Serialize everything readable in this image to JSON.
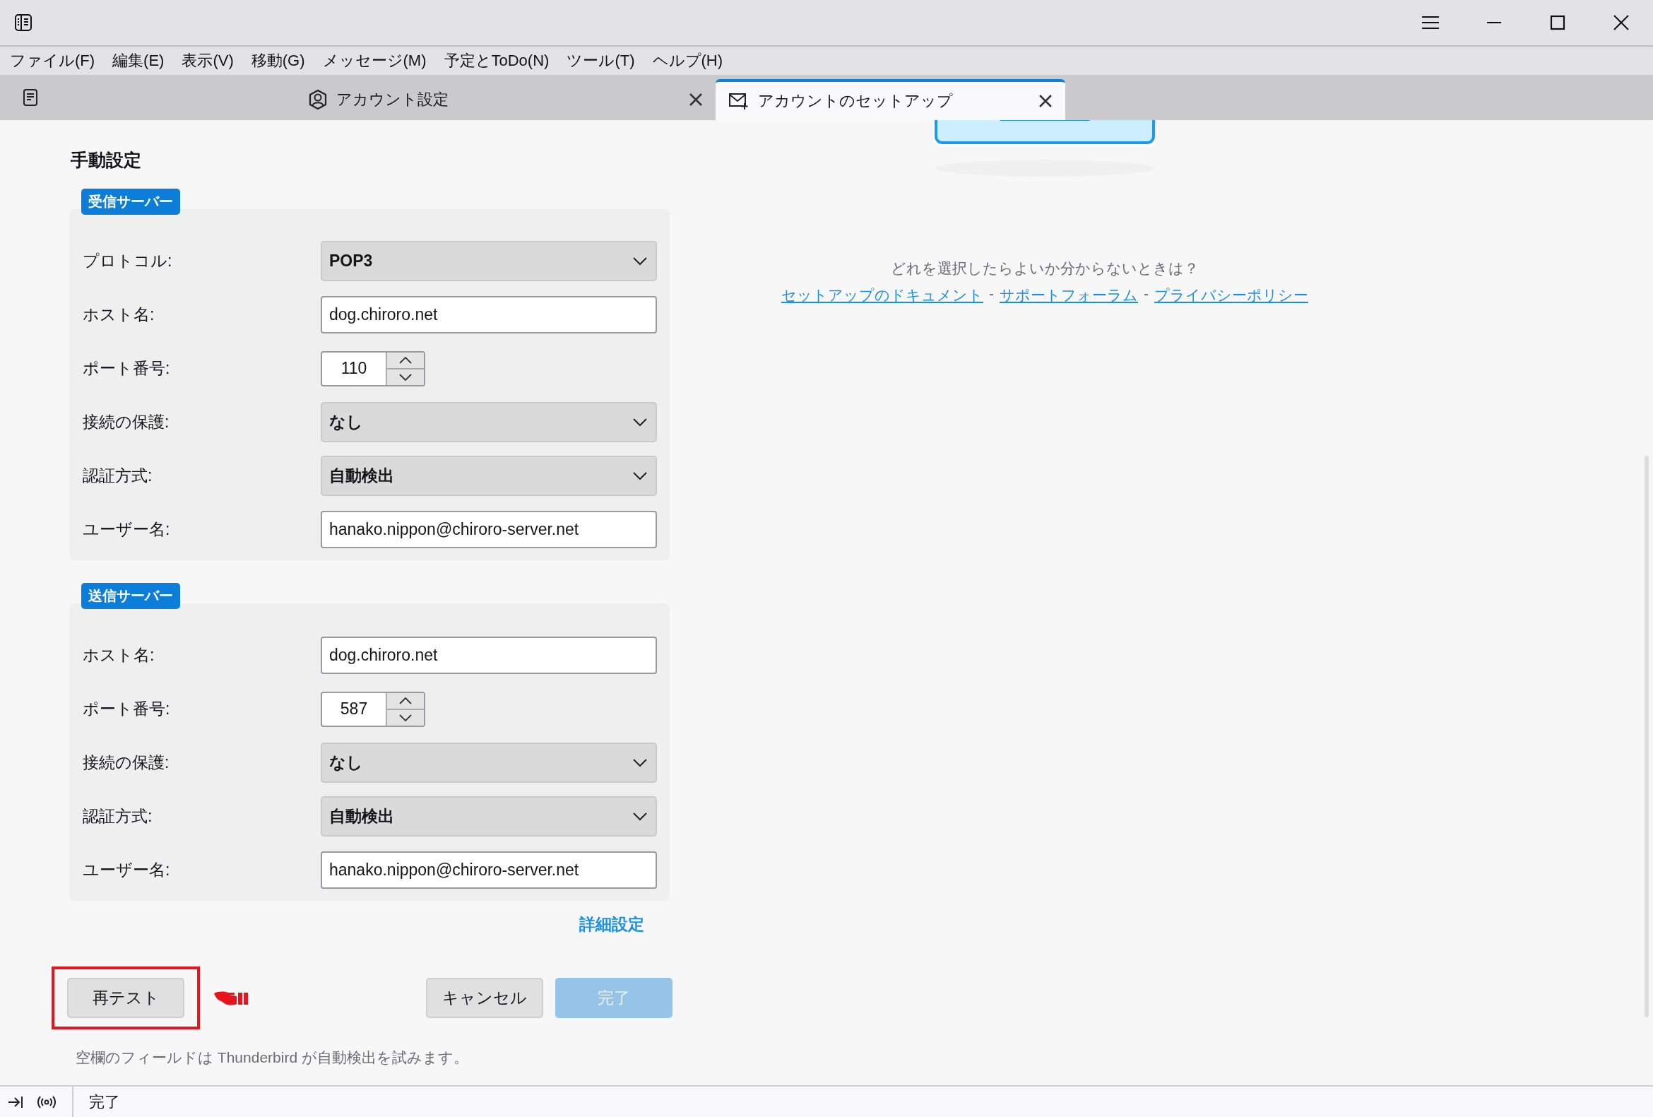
{
  "menu": [
    "ファイル(F)",
    "編集(E)",
    "表示(V)",
    "移動(G)",
    "メッセージ(M)",
    "予定とToDo(N)",
    "ツール(T)",
    "ヘルプ(H)"
  ],
  "tabs": [
    {
      "label": "アカウント設定",
      "kind": "account",
      "selected": false
    },
    {
      "label": "アカウントのセットアップ",
      "kind": "setup",
      "selected": true
    }
  ],
  "manual": {
    "heading": "手動設定",
    "sections": [
      {
        "badge": "受信サーバー",
        "rows": [
          {
            "kind": "select",
            "label": "プロトコル:",
            "value": "POP3"
          },
          {
            "kind": "text",
            "label": "ホスト名:",
            "value": "dog.chiroro.net"
          },
          {
            "kind": "spin",
            "label": "ポート番号:",
            "value": "110"
          },
          {
            "kind": "select",
            "label": "接続の保護:",
            "value": "なし"
          },
          {
            "kind": "select",
            "label": "認証方式:",
            "value": "自動検出"
          },
          {
            "kind": "text",
            "label": "ユーザー名:",
            "value": "hanako.nippon@chiroro-server.net"
          }
        ]
      },
      {
        "badge": "送信サーバー",
        "rows": [
          {
            "kind": "text",
            "label": "ホスト名:",
            "value": "dog.chiroro.net"
          },
          {
            "kind": "spin",
            "label": "ポート番号:",
            "value": "587"
          },
          {
            "kind": "select",
            "label": "接続の保護:",
            "value": "なし"
          },
          {
            "kind": "select",
            "label": "認証方式:",
            "value": "自動検出"
          },
          {
            "kind": "text",
            "label": "ユーザー名:",
            "value": "hanako.nippon@chiroro-server.net"
          }
        ]
      }
    ],
    "advanced_link": "詳細設定",
    "retest": {
      "label": "再テスト",
      "highlighted": true
    },
    "buttons": [
      {
        "label": "キャンセル",
        "kind": "default",
        "disabled": false
      },
      {
        "label": "完了",
        "kind": "primary",
        "disabled": true
      }
    ],
    "note": "空欄のフィールドは Thunderbird が自動検出を試みます。"
  },
  "help": {
    "question": "どれを選択したらよいか分からないときは？",
    "links": [
      "セットアップのドキュメント",
      "サポートフォーラム",
      "プライバシーポリシー"
    ],
    "separator": "-"
  },
  "status_bar": {
    "text": "完了"
  }
}
